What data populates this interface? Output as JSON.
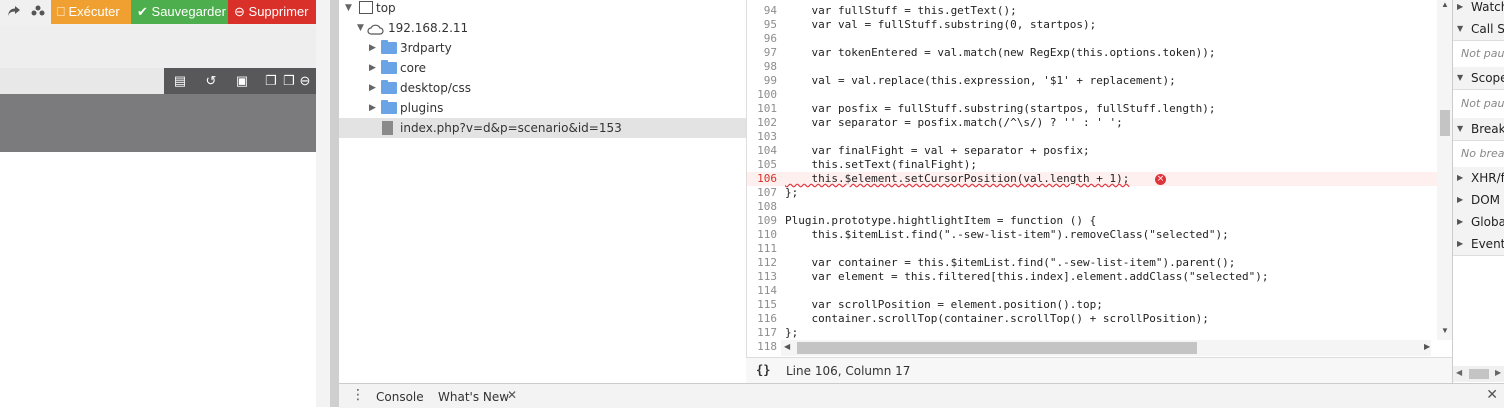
{
  "app": {
    "toolbar": {
      "execute_label": "Exécuter",
      "save_label": "Sauvegarder",
      "delete_label": "Supprimer"
    },
    "icons": [
      "share-icon",
      "users-icon",
      "list-icon",
      "history-icon",
      "cube-icon",
      "copy-icon",
      "paste-icon",
      "minus-circle-icon"
    ]
  },
  "navigator": {
    "items": [
      {
        "label": "top"
      },
      {
        "label": "192.168.2.11"
      },
      {
        "label": "3rdparty"
      },
      {
        "label": "core"
      },
      {
        "label": "desktop/css"
      },
      {
        "label": "plugins"
      },
      {
        "label": "index.php?v=d&p=scenario&id=153"
      }
    ]
  },
  "editor": {
    "lines": [
      {
        "n": "94",
        "text": "    var fullStuff = this.getText();"
      },
      {
        "n": "95",
        "text": "    var val = fullStuff.substring(0, startpos);"
      },
      {
        "n": "96",
        "text": ""
      },
      {
        "n": "97",
        "text": "    var tokenEntered = val.match(new RegExp(this.options.token));"
      },
      {
        "n": "98",
        "text": ""
      },
      {
        "n": "99",
        "text": "    val = val.replace(this.expression, '$1' + replacement);"
      },
      {
        "n": "100",
        "text": ""
      },
      {
        "n": "101",
        "text": "    var posfix = fullStuff.substring(startpos, fullStuff.length);"
      },
      {
        "n": "102",
        "text": "    var separator = posfix.match(/^\\s/) ? '' : ' ';"
      },
      {
        "n": "103",
        "text": ""
      },
      {
        "n": "104",
        "text": "    var finalFight = val + separator + posfix;"
      },
      {
        "n": "105",
        "text": "    this.setText(finalFight);"
      },
      {
        "n": "106",
        "text": "    this.$element.setCursorPosition(val.length + 1);"
      },
      {
        "n": "107",
        "text": "};"
      },
      {
        "n": "108",
        "text": ""
      },
      {
        "n": "109",
        "text": "Plugin.prototype.hightlightItem = function () {"
      },
      {
        "n": "110",
        "text": "    this.$itemList.find(\".-sew-list-item\").removeClass(\"selected\");"
      },
      {
        "n": "111",
        "text": ""
      },
      {
        "n": "112",
        "text": "    var container = this.$itemList.find(\".-sew-list-item\").parent();"
      },
      {
        "n": "113",
        "text": "    var element = this.filtered[this.index].element.addClass(\"selected\");"
      },
      {
        "n": "114",
        "text": ""
      },
      {
        "n": "115",
        "text": "    var scrollPosition = element.position().top;"
      },
      {
        "n": "116",
        "text": "    container.scrollTop(container.scrollTop() + scrollPosition);"
      },
      {
        "n": "117",
        "text": "};"
      },
      {
        "n": "118",
        "text": ""
      }
    ],
    "status": "Line 106, Column 17"
  },
  "sidebar": {
    "sections": [
      {
        "label": "Watch"
      },
      {
        "label": "Call St"
      },
      {
        "label": "Not paus",
        "italic": true
      },
      {
        "label": "Scope"
      },
      {
        "label": "Not paus",
        "italic": true
      },
      {
        "label": "Breakp"
      },
      {
        "label": "No break",
        "italic": true
      },
      {
        "label": "XHR/fe"
      },
      {
        "label": "DOM B"
      },
      {
        "label": "Global"
      },
      {
        "label": "Event"
      }
    ]
  },
  "drawer": {
    "tab1": "Console",
    "tab2": "What's New"
  },
  "colors": {
    "execute": "#f0a030",
    "save": "#4cae4c",
    "delete": "#d9302a",
    "error": "#e0323a"
  }
}
